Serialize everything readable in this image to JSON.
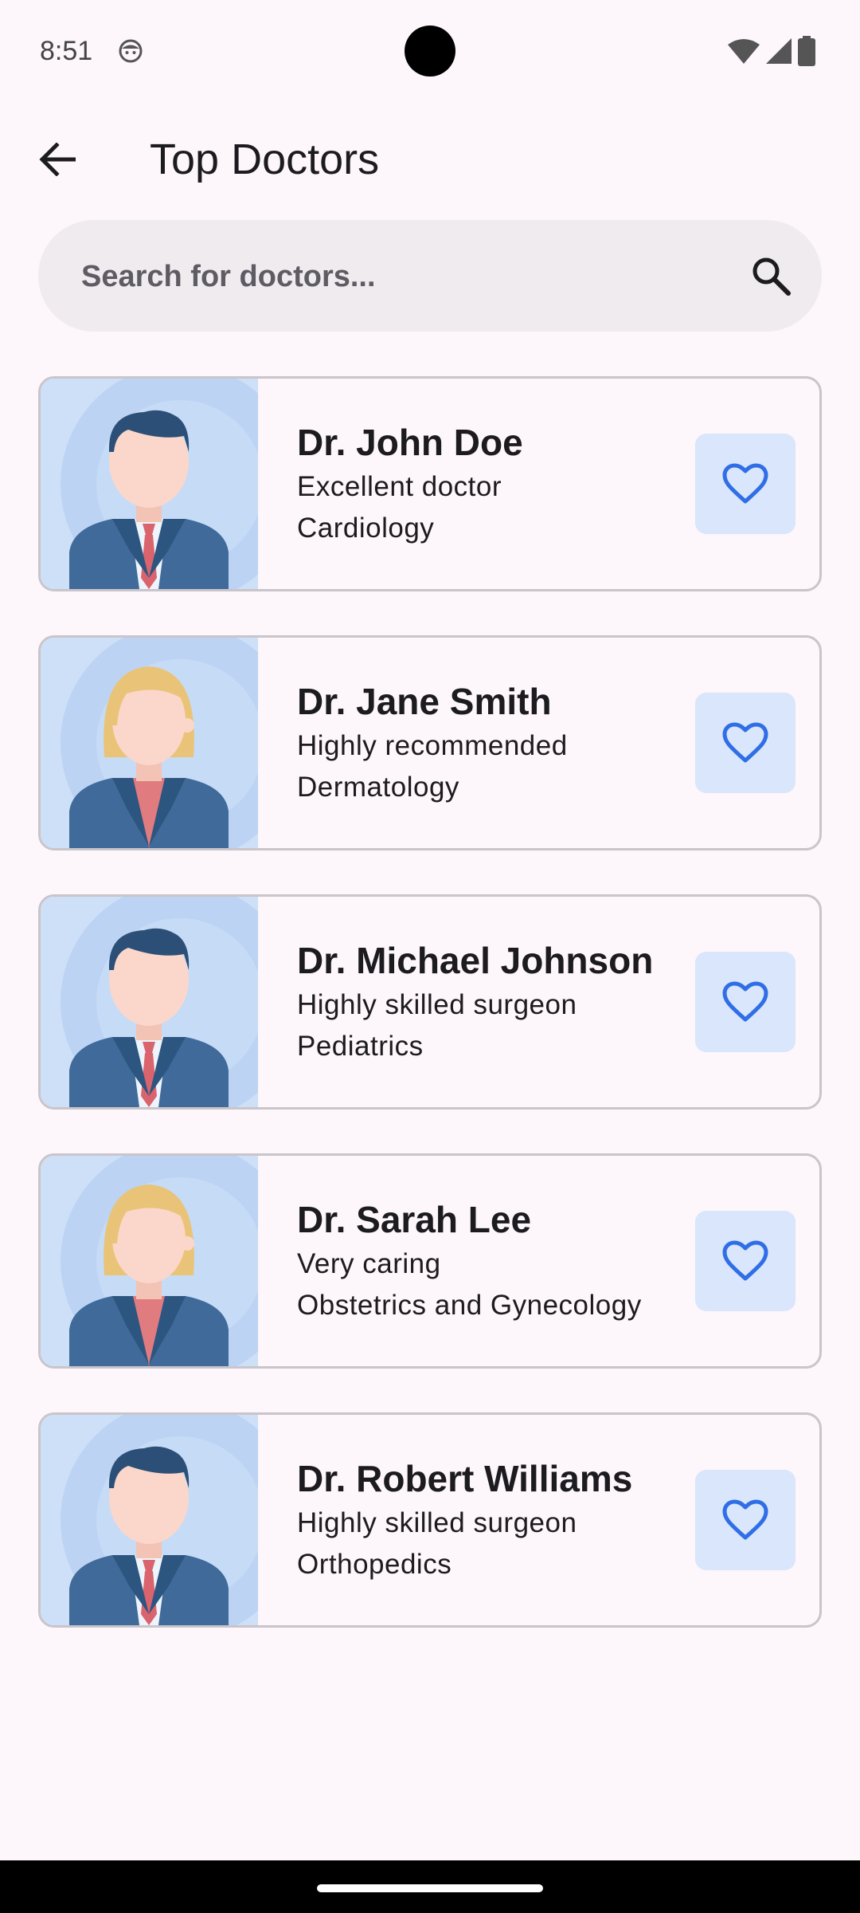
{
  "status_bar": {
    "time": "8:51",
    "app_icon": "android-face-icon",
    "icons": [
      "wifi-icon",
      "cellular-signal-icon",
      "battery-icon"
    ]
  },
  "app_bar": {
    "back_icon": "arrow-left-icon",
    "title": "Top Doctors"
  },
  "search": {
    "placeholder": "Search for doctors...",
    "value": "",
    "icon": "search-icon"
  },
  "doctors": [
    {
      "name": "Dr. John Doe",
      "review": "Excellent doctor",
      "specialty": "Cardiology",
      "avatar": "male-doctor-avatar",
      "favorite_icon": "heart-outline-icon"
    },
    {
      "name": "Dr. Jane Smith",
      "review": "Highly recommended",
      "specialty": "Dermatology",
      "avatar": "female-doctor-avatar",
      "favorite_icon": "heart-outline-icon"
    },
    {
      "name": "Dr. Michael Johnson",
      "review": "Highly skilled surgeon",
      "specialty": "Pediatrics",
      "avatar": "male-doctor-avatar",
      "favorite_icon": "heart-outline-icon"
    },
    {
      "name": "Dr. Sarah Lee",
      "review": "Very caring",
      "specialty": "Obstetrics and Gynecology",
      "avatar": "female-doctor-avatar",
      "favorite_icon": "heart-outline-icon"
    },
    {
      "name": "Dr. Robert Williams",
      "review": "Highly skilled surgeon",
      "specialty": "Orthopedics",
      "avatar": "male-doctor-avatar",
      "favorite_icon": "heart-outline-icon"
    }
  ],
  "colors": {
    "background": "#fdf6fb",
    "search_background": "#efebef",
    "card_border": "#c9c5ca",
    "avatar_background": "#cde0f7",
    "favorite_button_background": "#d9e6fb",
    "favorite_icon": "#2f6ee6",
    "text_primary": "#1c1b1f"
  }
}
